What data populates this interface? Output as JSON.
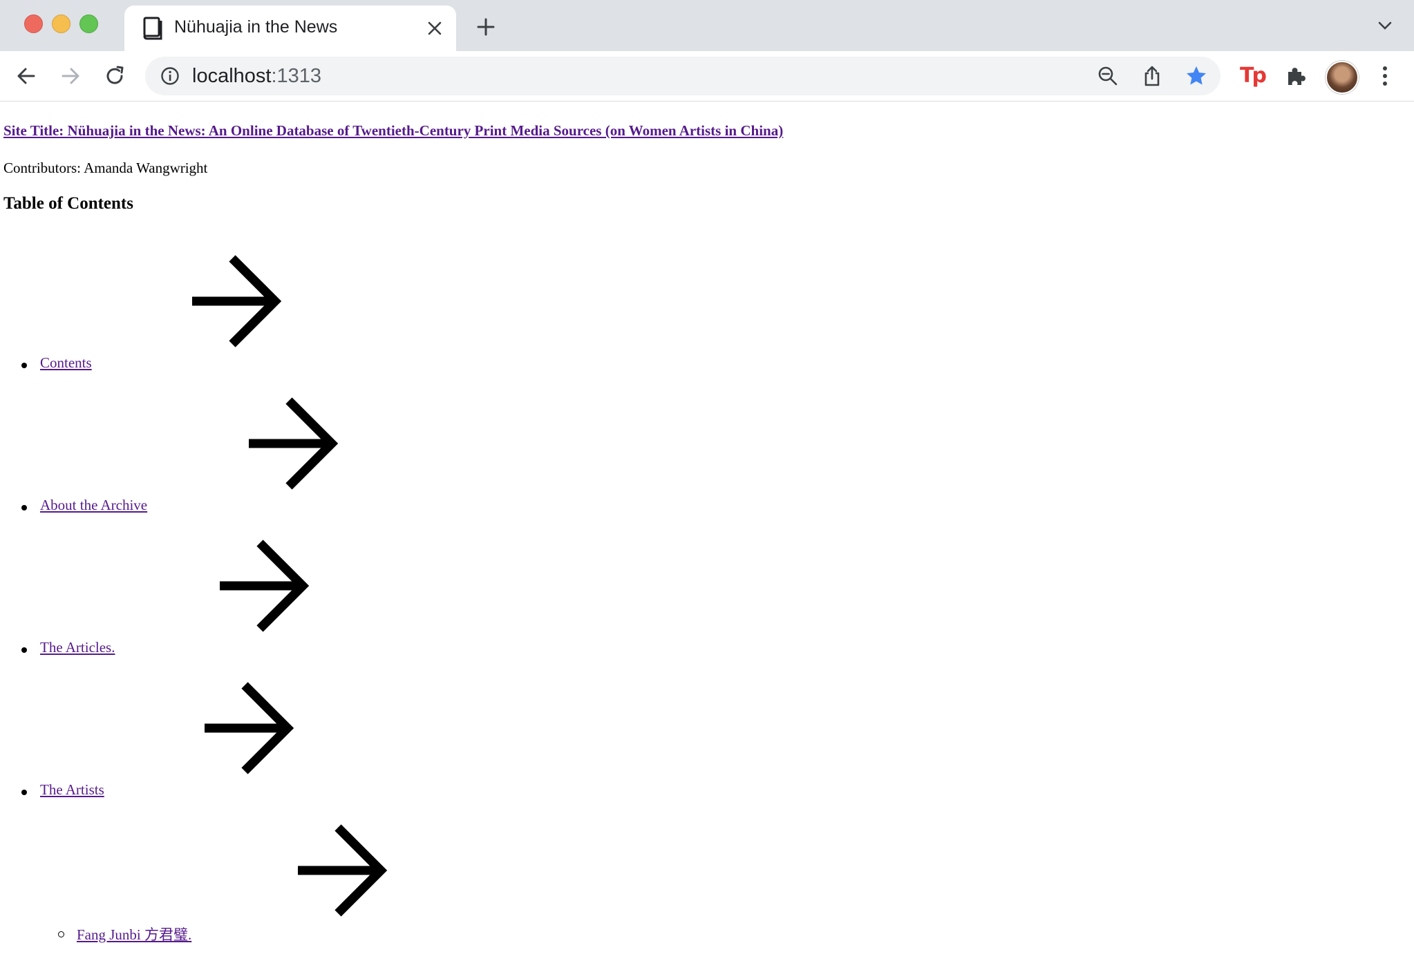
{
  "browser": {
    "tab_title": "Nühuajia in the News",
    "url_host": "localhost",
    "url_port": ":1313",
    "icons": {
      "favicon": "book-icon",
      "close": "close-icon",
      "new_tab": "plus-icon",
      "tab_menu": "chevron-down-icon",
      "back": "arrow-left-icon",
      "forward": "arrow-right-icon",
      "reload": "reload-icon",
      "info": "info-icon",
      "zoom": "zoom-out-icon",
      "share": "share-icon",
      "bookmark": "star-icon",
      "extension_tp": "tp-extension-icon",
      "extensions": "puzzle-icon",
      "profile": "avatar",
      "menu": "kebab-menu-icon"
    },
    "colors": {
      "tabbar": "#dee1e6",
      "bookmark_star": "#4285f4",
      "tp_extension": "#e53935"
    }
  },
  "page": {
    "site_title": "Site Title: Nühuajia in the News: An Online Database of Twentieth-Century Print Media Sources (on Women Artists in China)",
    "contributors": "Contributors: Amanda Wangwright",
    "toc_heading": "Table of Contents",
    "toc": [
      {
        "label": "Contents ",
        "level": 1
      },
      {
        "label": "About the Archive ",
        "level": 1
      },
      {
        "label": "The Articles. ",
        "level": 1
      },
      {
        "label": "The Artists ",
        "level": 1
      },
      {
        "label": "Fang Junbi 方君璧. ",
        "level": 2
      }
    ],
    "link_color": "#551a8b"
  }
}
